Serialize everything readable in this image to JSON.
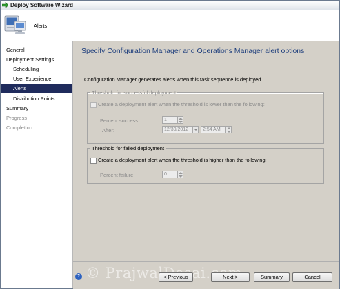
{
  "window": {
    "title": "Deploy Software Wizard"
  },
  "header": {
    "title": "Alerts",
    "icon": "computer-icon"
  },
  "nav": {
    "items": [
      {
        "label": "General",
        "level": 0,
        "state": "normal"
      },
      {
        "label": "Deployment Settings",
        "level": 0,
        "state": "normal"
      },
      {
        "label": "Scheduling",
        "level": 1,
        "state": "normal"
      },
      {
        "label": "User Experience",
        "level": 1,
        "state": "normal"
      },
      {
        "label": "Alerts",
        "level": 1,
        "state": "selected"
      },
      {
        "label": "Distribution Points",
        "level": 1,
        "state": "normal"
      },
      {
        "label": "Summary",
        "level": 0,
        "state": "normal"
      },
      {
        "label": "Progress",
        "level": 0,
        "state": "disabled"
      },
      {
        "label": "Completion",
        "level": 0,
        "state": "disabled"
      }
    ]
  },
  "content": {
    "heading": "Specify Configuration Manager and Operations Manager alert options",
    "intro": "Configuration Manager generates alerts when this task sequence is deployed.",
    "success_group": {
      "legend": "Threshold for successful deployment",
      "checkbox_label": "Create a deployment alert when the threshold is lower than the following:",
      "checked": false,
      "percent_label": "Percent success:",
      "percent_value": "1",
      "after_label": "After:",
      "date_value": "12/30/2012",
      "time_value": "2:54 AM"
    },
    "failed_group": {
      "legend": "Threshold for failed deployment",
      "checkbox_label": "Create a deployment alert when the threshold is higher than the following:",
      "checked": false,
      "percent_label": "Percent failure:",
      "percent_value": "0"
    }
  },
  "footer": {
    "help_icon": "help-icon",
    "previous_label": "< Previous",
    "next_label": "Next >",
    "summary_label": "Summary",
    "cancel_label": "Cancel",
    "watermark": "© PrajwalDesai.com"
  },
  "colors": {
    "heading": "#1f3f7d",
    "selected_nav": "#1f2b5c",
    "dialog_bg": "#d4d0c8"
  }
}
